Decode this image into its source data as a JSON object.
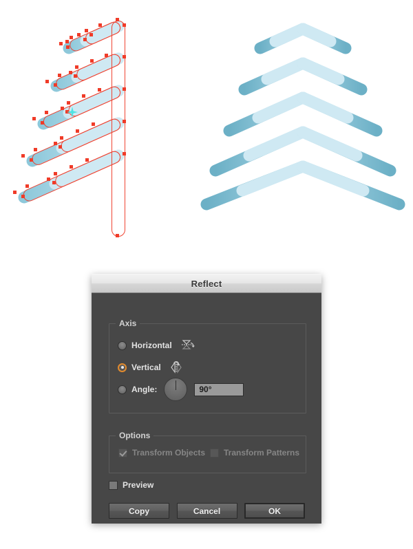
{
  "artwork": {
    "description": "Two fir-tree illustrations: left one shows selected paths with red anchor points, right one is the completed reflected tree",
    "trunk_color": "#c1664a",
    "branch_outer_color": "#6cb0c6",
    "branch_inner_color": "#a9d5e4",
    "branch_mid_color": "#8ac3d6",
    "selection_color": "#f03b28",
    "origin_marker_color": "#4fe3e3",
    "left_tree_label": "selected-half-tree",
    "right_tree_label": "reflected-full-tree"
  },
  "dialog": {
    "title": "Reflect",
    "axis": {
      "legend": "Axis",
      "options": [
        {
          "id": "horizontal",
          "label": "Horizontal",
          "selected": false,
          "icon": "reflect-horizontal-icon"
        },
        {
          "id": "vertical",
          "label": "Vertical",
          "selected": true,
          "icon": "reflect-vertical-icon"
        },
        {
          "id": "angle",
          "label": "Angle:",
          "selected": false,
          "icon": "angle-dial-icon"
        }
      ],
      "angle_value": "90°",
      "angle_placeholder": "90°"
    },
    "options": {
      "legend": "Options",
      "checkboxes": [
        {
          "id": "transform-objects",
          "label": "Transform Objects",
          "checked": true,
          "disabled": true
        },
        {
          "id": "transform-patterns",
          "label": "Transform Patterns",
          "checked": false,
          "disabled": true
        }
      ]
    },
    "preview": {
      "label": "Preview",
      "checked": false
    },
    "buttons": [
      {
        "id": "copy",
        "label": "Copy",
        "default": false
      },
      {
        "id": "cancel",
        "label": "Cancel",
        "default": false
      },
      {
        "id": "ok",
        "label": "OK",
        "default": true
      }
    ],
    "accent_color": "#e08a2e",
    "background_color": "#474747",
    "titlebar_text_color": "#3a3a3a"
  }
}
